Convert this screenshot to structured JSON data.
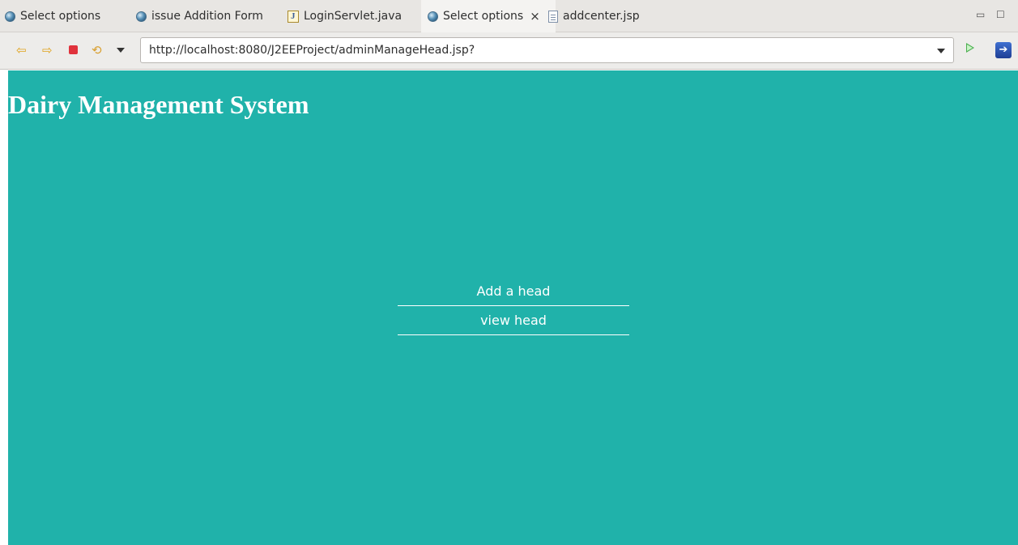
{
  "tabs": [
    {
      "label": "Select options",
      "icon": "globe-icon",
      "active": false
    },
    {
      "label": "issue Addition Form",
      "icon": "globe-icon",
      "active": false
    },
    {
      "label": "LoginServlet.java",
      "icon": "java-file-icon",
      "active": false
    },
    {
      "label": "Select options",
      "icon": "globe-icon",
      "active": true,
      "close": "×"
    },
    {
      "label": "addcenter.jsp",
      "icon": "jsp-file-icon",
      "active": false
    }
  ],
  "window_controls": {
    "minimize": "▭",
    "maximize": "☐"
  },
  "toolbar": {
    "url": "http://localhost:8080/J2EEProject/adminManageHead.jsp?"
  },
  "page": {
    "title": "Dairy Management System",
    "background": "#20b2aa",
    "menu": [
      {
        "label": "Add a head"
      },
      {
        "label": "view head"
      }
    ]
  }
}
